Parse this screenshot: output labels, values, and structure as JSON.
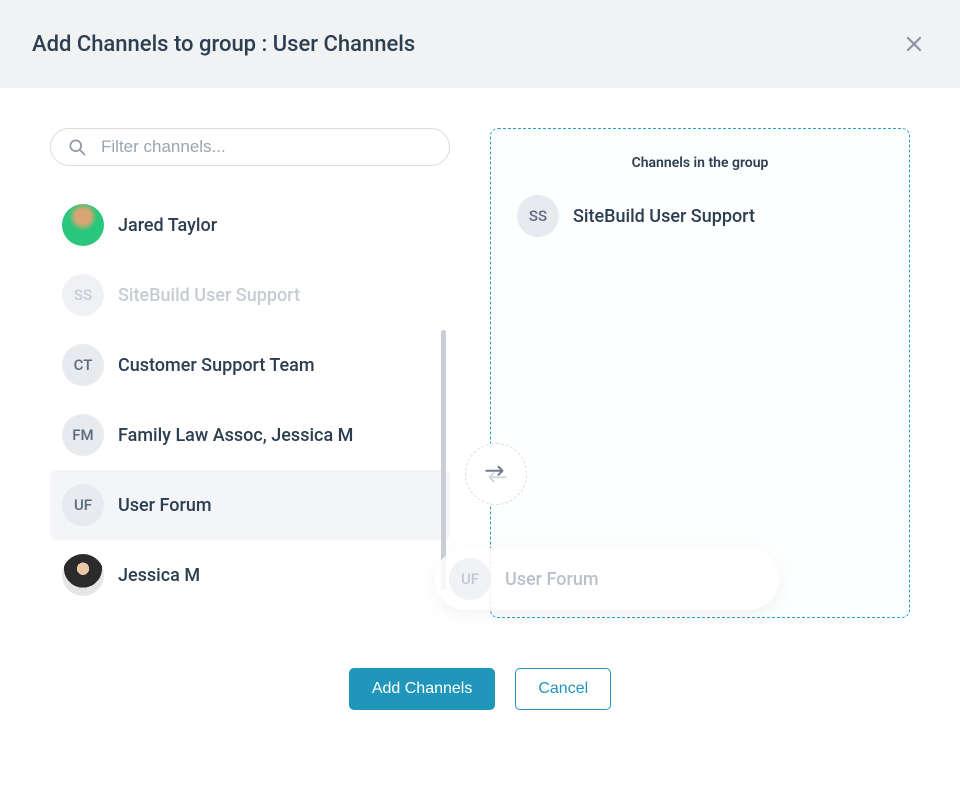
{
  "header": {
    "title": "Add Channels to group : User Channels"
  },
  "search": {
    "placeholder": "Filter channels..."
  },
  "channels": [
    {
      "label": "Jared Taylor",
      "initials": "",
      "avatar": "jared",
      "state": "normal"
    },
    {
      "label": "SiteBuild User Support",
      "initials": "SS",
      "avatar": "",
      "state": "disabled"
    },
    {
      "label": "Customer Support Team",
      "initials": "CT",
      "avatar": "",
      "state": "normal"
    },
    {
      "label": "Family Law Assoc, Jessica M",
      "initials": "FM",
      "avatar": "",
      "state": "normal"
    },
    {
      "label": "User Forum",
      "initials": "UF",
      "avatar": "",
      "state": "active"
    },
    {
      "label": "Jessica M",
      "initials": "",
      "avatar": "jessica",
      "state": "normal"
    }
  ],
  "dropzone": {
    "title": "Channels in the group",
    "items": [
      {
        "label": "SiteBuild User Support",
        "initials": "SS"
      }
    ]
  },
  "dragGhost": {
    "label": "User Forum",
    "initials": "UF"
  },
  "footer": {
    "primary": "Add Channels",
    "secondary": "Cancel"
  }
}
